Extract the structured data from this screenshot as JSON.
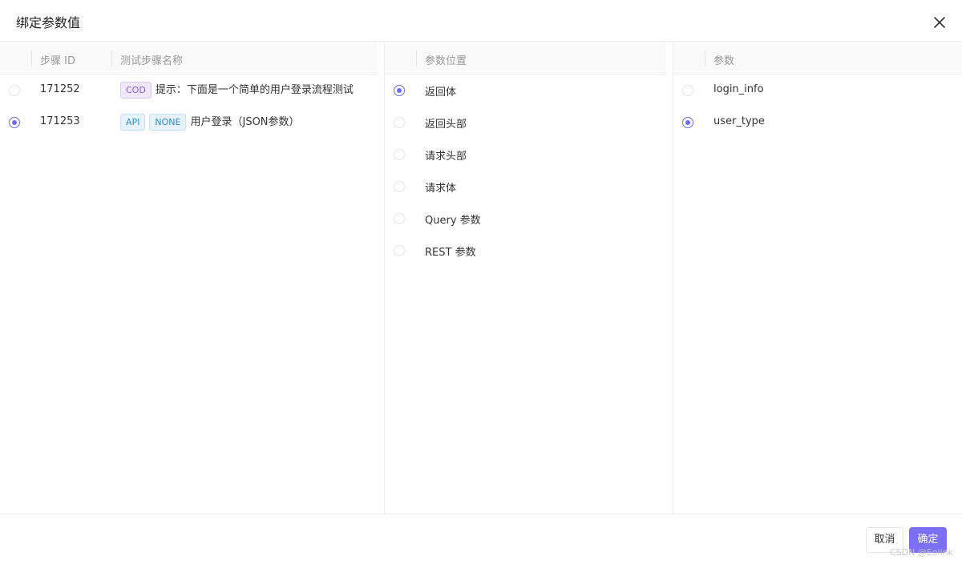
{
  "dialog": {
    "title": "绑定参数值",
    "close_icon": "close-icon"
  },
  "steps": {
    "headers": {
      "id": "步骤 ID",
      "name": "测试步骤名称"
    },
    "rows": [
      {
        "id": "171252",
        "tags": [
          "COD"
        ],
        "name": "提示：下面是一个简单的用户登录流程测试",
        "selected": false
      },
      {
        "id": "171253",
        "tags": [
          "API",
          "NONE"
        ],
        "name": "用户登录（JSON参数）",
        "selected": true
      }
    ]
  },
  "positions": {
    "header": "参数位置",
    "items": [
      {
        "label": "返回体",
        "selected": true
      },
      {
        "label": "返回头部",
        "selected": false
      },
      {
        "label": "请求头部",
        "selected": false
      },
      {
        "label": "请求体",
        "selected": false
      },
      {
        "label": "Query 参数",
        "selected": false
      },
      {
        "label": "REST 参数",
        "selected": false
      }
    ]
  },
  "params": {
    "header": "参数",
    "items": [
      {
        "label": "login_info",
        "selected": false
      },
      {
        "label": "user_type",
        "selected": true
      }
    ]
  },
  "footer": {
    "cancel_label": "取消",
    "ok_label": "确定"
  },
  "watermark": "CSDN @Eolink",
  "colors": {
    "accent": "#7b70f5",
    "radio_checked": "#6b6bf0"
  }
}
